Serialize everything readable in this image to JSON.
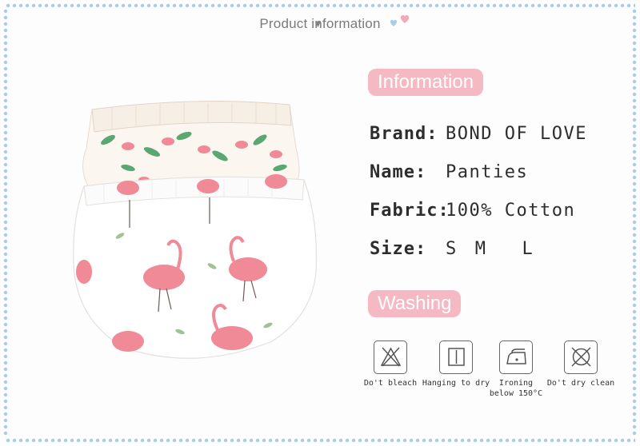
{
  "header": {
    "title": "Product information"
  },
  "sections": {
    "information_label": "Information",
    "washing_label": "Washing"
  },
  "specs": [
    {
      "label": "Brand:",
      "value": "BOND OF LOVE"
    },
    {
      "label": "Name:",
      "value": "Panties"
    },
    {
      "label": "Fabric:",
      "value": "100% Cotton"
    },
    {
      "label": "Size:",
      "sizes": [
        "S",
        "M",
        "L"
      ]
    }
  ],
  "care": [
    {
      "icon": "no-bleach-icon",
      "label": "Do't bleach"
    },
    {
      "icon": "hang-dry-icon",
      "label": "Hanging to dry"
    },
    {
      "icon": "iron-icon",
      "label_line1": "Ironing",
      "label_line2": "below 150°C"
    },
    {
      "icon": "no-dry-clean-icon",
      "label": "Do't dry clean"
    }
  ],
  "colors": {
    "pill": "#f5b9c4",
    "border_dots": "#a8cdea",
    "flamingo": "#ef8a96",
    "leaf": "#3e9a5c"
  }
}
